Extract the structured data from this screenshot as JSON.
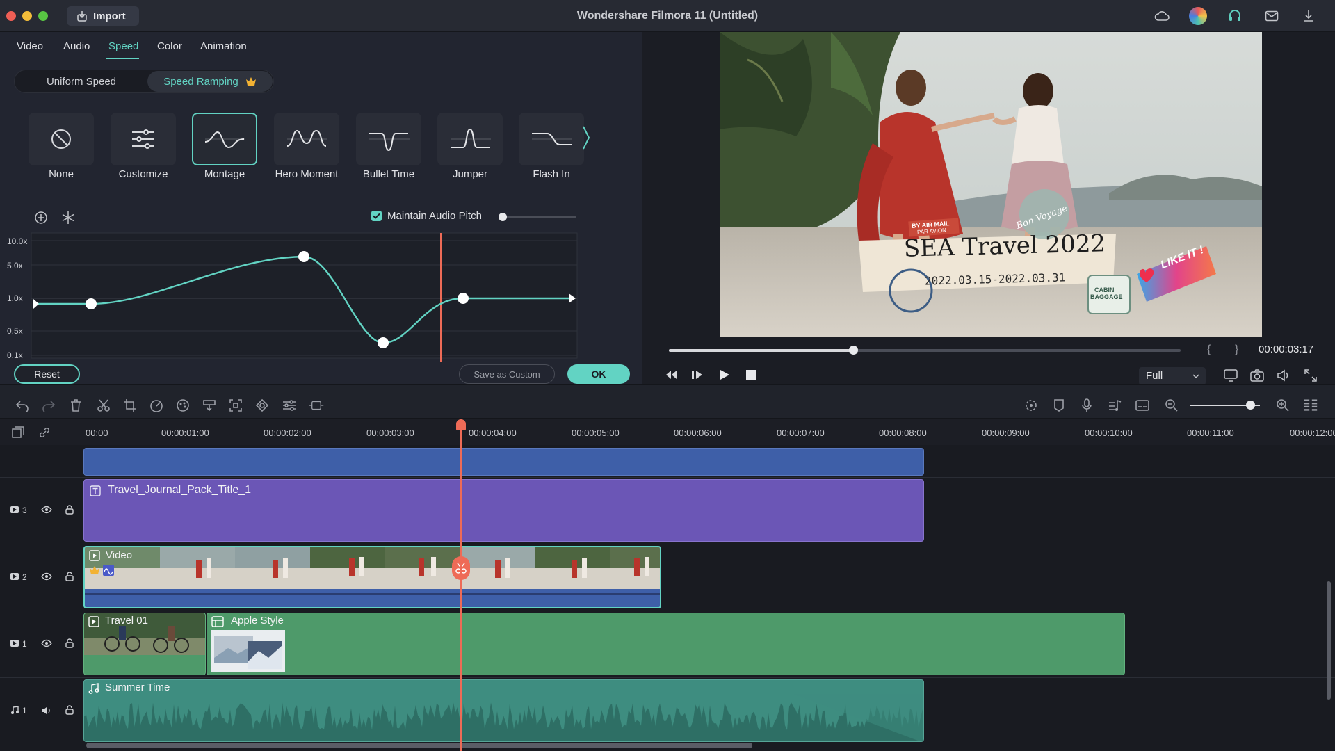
{
  "window": {
    "title": "Wondershare Filmora 11 (Untitled)",
    "import_label": "Import"
  },
  "properties": {
    "tabs": [
      {
        "label": "Video"
      },
      {
        "label": "Audio"
      },
      {
        "label": "Speed",
        "active": true
      },
      {
        "label": "Color"
      },
      {
        "label": "Animation"
      }
    ],
    "speed_modes": {
      "uniform": "Uniform Speed",
      "ramping": "Speed Ramping"
    },
    "presets": [
      {
        "label": "None",
        "icon": "prohibit-icon"
      },
      {
        "label": "Customize",
        "icon": "sliders-icon"
      },
      {
        "label": "Montage",
        "icon": "montage-curve-icon",
        "selected": true
      },
      {
        "label": "Hero Moment",
        "icon": "hero-moment-curve-icon"
      },
      {
        "label": "Bullet Time",
        "icon": "bullet-time-curve-icon"
      },
      {
        "label": "Jumper",
        "icon": "jumper-curve-icon"
      },
      {
        "label": "Flash In",
        "icon": "flash-in-curve-icon"
      }
    ],
    "maintain_audio_pitch": "Maintain Audio Pitch",
    "maintain_audio_pitch_checked": true,
    "graph_axis": [
      "10.0x",
      "5.0x",
      "1.0x",
      "0.5x",
      "0.1x"
    ],
    "buttons": {
      "reset": "Reset",
      "save_custom": "Save as Custom",
      "ok": "OK"
    }
  },
  "preview": {
    "timecode": "00:00:03:17",
    "quality": "Full",
    "overlay": {
      "title": "SEA Travel 2022",
      "dates": "2022.03.15-2022.03.31",
      "air_mail": "BY AIR MAIL",
      "par_avion": "PAR AVION",
      "like": "LIKE IT !",
      "bon_voyage": "Bon Voyage",
      "cabin": "CABIN",
      "baggage": "BAGGAGE"
    },
    "progress": 0.36
  },
  "ruler": {
    "ticks": [
      "00:00",
      "00:00:01:00",
      "00:00:02:00",
      "00:00:03:00",
      "00:00:04:00",
      "00:00:05:00",
      "00:00:06:00",
      "00:00:07:00",
      "00:00:08:00",
      "00:00:09:00",
      "00:00:10:00",
      "00:00:11:00",
      "00:00:12:00"
    ]
  },
  "tracks": {
    "track3_num": "3",
    "track2_num": "2",
    "track1_num": "1",
    "audio1_num": "1",
    "clips": {
      "title_clip": "Travel_Journal_Pack_Title_1",
      "video_clip": "Video",
      "travel_clip": "Travel 01",
      "apple_clip": "Apple Style",
      "audio_clip": "Summer Time"
    }
  },
  "colors": {
    "accent": "#62d3c3",
    "playhead": "#ee6b57",
    "title_clip": "#6b56b6",
    "video_clip": "#3e5fa8",
    "green_clip": "#4e9a6a",
    "audio_clip": "#3e8d80"
  }
}
